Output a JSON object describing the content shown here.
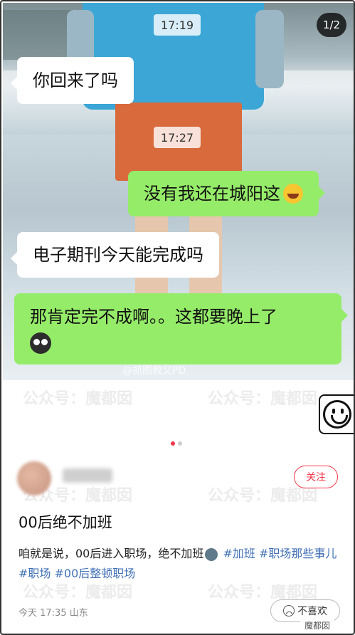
{
  "photo": {
    "page_counter": "1/2",
    "weibo_watermark": "@抓图教父PD"
  },
  "chat": {
    "time1": "17:19",
    "msg1": "你回来了吗",
    "time2": "17:27",
    "msg2": "没有我还在城阳这",
    "msg3": "电子期刊今天能完成吗",
    "msg4": "那肯定完不成啊。。这都要晚上了"
  },
  "watermark": "公众号：魔都囡",
  "post": {
    "follow_label": "关注",
    "title": "00后绝不加班",
    "body_text": "咱就是说，00后进入职场，绝不加班",
    "tags": [
      "#加班",
      "#职场那些事儿",
      "#职场",
      "#00后整顿职场"
    ],
    "meta": "今天 17:35 山东",
    "dislike_label": "不喜欢",
    "badge": "魔都囡"
  },
  "colors": {
    "accent": "#f0374a",
    "bubble_green": "#95ec69",
    "tag": "#3f6fb5"
  }
}
